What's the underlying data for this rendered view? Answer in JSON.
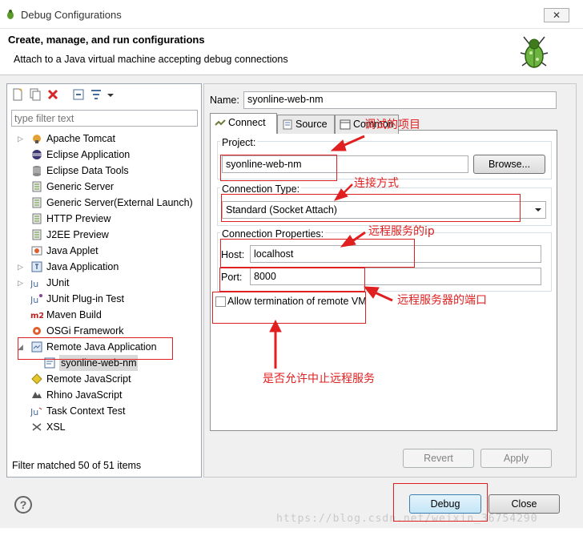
{
  "window": {
    "title": "Debug Configurations",
    "close_glyph": "✕"
  },
  "header": {
    "title": "Create, manage, and run configurations",
    "description": "Attach to a Java virtual machine accepting debug connections"
  },
  "filter": {
    "placeholder": "type filter text",
    "status": "Filter matched 50 of 51 items"
  },
  "tree": [
    {
      "label": "Apache Tomcat",
      "icon": "tomcat-icon",
      "expandable": true
    },
    {
      "label": "Eclipse Application",
      "icon": "eclipse-icon",
      "expandable": false
    },
    {
      "label": "Eclipse Data Tools",
      "icon": "database-icon",
      "expandable": false
    },
    {
      "label": "Generic Server",
      "icon": "server-icon",
      "expandable": false
    },
    {
      "label": "Generic Server(External Launch)",
      "icon": "server-icon",
      "expandable": false
    },
    {
      "label": "HTTP Preview",
      "icon": "server-icon",
      "expandable": false
    },
    {
      "label": "J2EE Preview",
      "icon": "server-icon",
      "expandable": false
    },
    {
      "label": "Java Applet",
      "icon": "applet-icon",
      "expandable": false
    },
    {
      "label": "Java Application",
      "icon": "java-app-icon",
      "expandable": true
    },
    {
      "label": "JUnit",
      "icon": "junit-icon",
      "expandable": true
    },
    {
      "label": "JUnit Plug-in Test",
      "icon": "junit-plugin-icon",
      "expandable": false
    },
    {
      "label": "Maven Build",
      "icon": "maven-icon",
      "expandable": false
    },
    {
      "label": "OSGi Framework",
      "icon": "osgi-icon",
      "expandable": false
    },
    {
      "label": "Remote Java Application",
      "icon": "remote-java-icon",
      "expandable": true,
      "expanded": true
    },
    {
      "label": "syonline-web-nm",
      "icon": "config-icon",
      "child": true,
      "selected": true
    },
    {
      "label": "Remote JavaScript",
      "icon": "js-icon",
      "expandable": false
    },
    {
      "label": "Rhino JavaScript",
      "icon": "rhino-icon",
      "expandable": false
    },
    {
      "label": "Task Context Test",
      "icon": "task-icon",
      "expandable": false
    },
    {
      "label": "XSL",
      "icon": "xsl-icon",
      "expandable": false
    }
  ],
  "config": {
    "name_label": "Name:",
    "name_value": "syonline-web-nm",
    "tabs": [
      {
        "label": "Connect",
        "icon": "connect-icon",
        "active": true
      },
      {
        "label": "Source",
        "icon": "source-icon",
        "active": false
      },
      {
        "label": "Common",
        "icon": "common-icon",
        "active": false
      }
    ],
    "project": {
      "label": "Project:",
      "value": "syonline-web-nm",
      "browse": "Browse..."
    },
    "connection_type": {
      "label": "Connection Type:",
      "value": "Standard (Socket Attach)"
    },
    "connection_properties": {
      "label": "Connection Properties:",
      "host_label": "Host:",
      "host_value": "localhost",
      "port_label": "Port:",
      "port_value": "8000"
    },
    "allow_termination": {
      "label": "Allow termination of remote VM",
      "checked": false
    },
    "revert": "Revert",
    "apply": "Apply"
  },
  "footer": {
    "help": "?",
    "debug": "Debug",
    "close": "Close"
  },
  "annotations": {
    "project": "调试的项目",
    "connection": "连接方式",
    "ip": "远程服务的ip",
    "port": "远程服务器的端口",
    "terminate": "是否允许中止远程服务"
  },
  "watermark": "https://blog.csdn.net/weixin_36754290",
  "colors": {
    "annotation": "#e02020",
    "accent": "#3c7fb1"
  }
}
